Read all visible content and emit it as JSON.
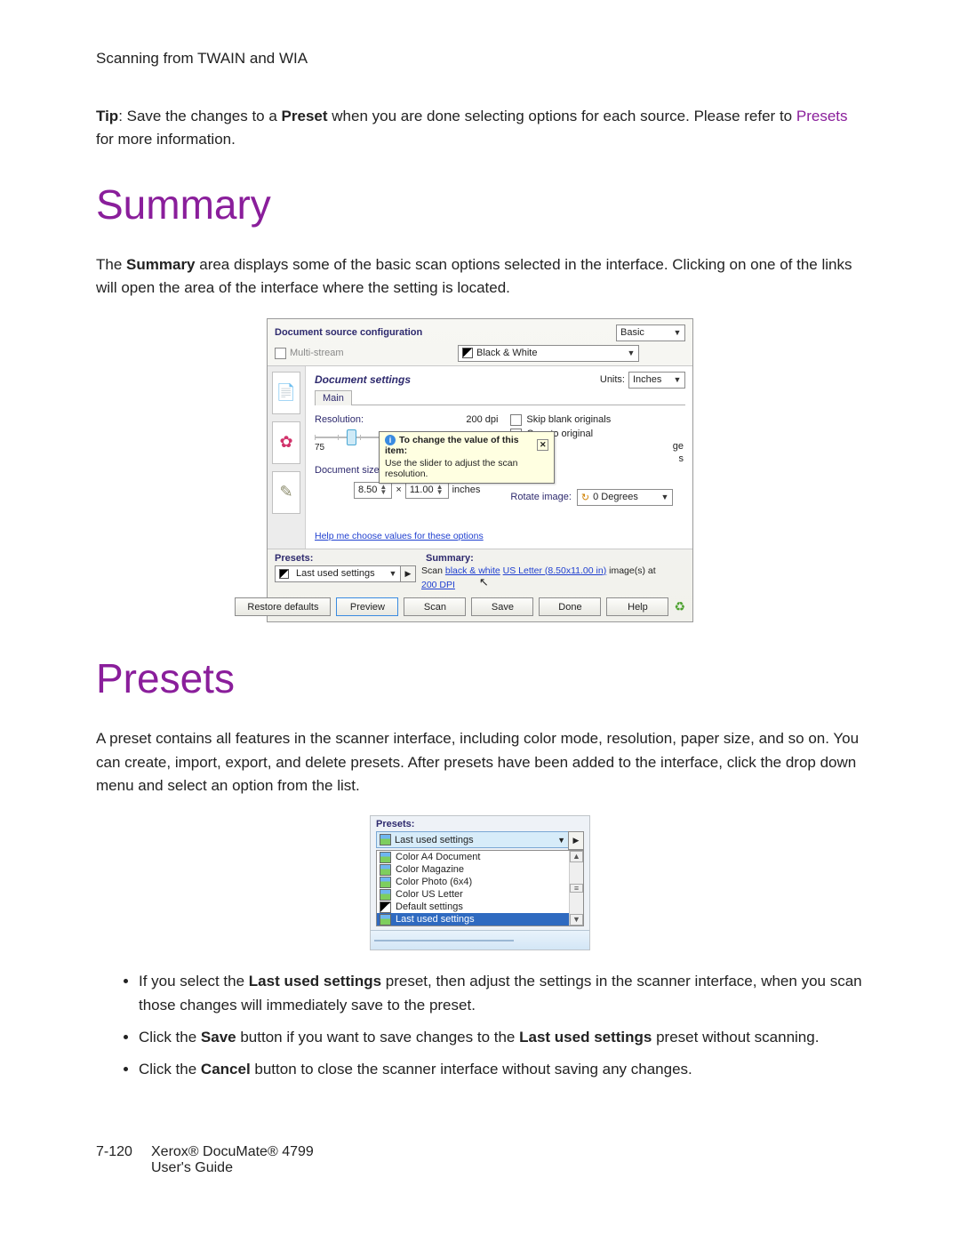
{
  "header": "Scanning from TWAIN and WIA",
  "tip": {
    "label": "Tip",
    "text1": ": Save the changes to a ",
    "bold1": "Preset",
    "text2": " when you are done selecting options for each source. Please refer to ",
    "link": "Presets",
    "text3": " for more information."
  },
  "sections": {
    "summary_title": "Summary",
    "summary_body_pre": "The ",
    "summary_body_bold": "Summary",
    "summary_body_post": " area displays some of the basic scan options selected in the interface. Clicking on one of the links will open the area of the interface where the setting is located.",
    "presets_title": "Presets",
    "presets_body": "A preset contains all features in the scanner interface, including color mode, resolution, paper size, and so on. You can create, import, export, and delete presets. After presets have been added to the interface, click the drop down menu and select an option from the list."
  },
  "dlg": {
    "src_cfg": "Document source configuration",
    "basic": "Basic",
    "multi": "Multi-stream",
    "bw": "Black & White",
    "panel_title": "Document settings",
    "units_label": "Units:",
    "units_value": "Inches",
    "tab": "Main",
    "resolution": "Resolution:",
    "res_value": "200 dpi",
    "slider_min": "75",
    "doc_size": "Document size:",
    "width": "8.50",
    "height": "11.00",
    "inches": "inches",
    "skip": "Skip blank originals",
    "crop": "Crop to original",
    "ge": "ge",
    "s_char": "s",
    "rotate": "Rotate image:",
    "rotate_value": "0 Degrees",
    "tooltip_t1": "To change the value of this item:",
    "tooltip_t2": "Use the slider to adjust the scan resolution.",
    "help_link": "Help me choose values for these options",
    "presets": "Presets:",
    "preset_value": "Last used settings",
    "summary": "Summary:",
    "sum1": "Scan ",
    "sum_u1": "black & white",
    "sum_sp": " ",
    "sum_u2": "US Letter (8.50x11.00 in)",
    "sum2": " image(s) at ",
    "sum_u3": "200 DPI",
    "btn_restore": "Restore defaults",
    "btn_preview": "Preview",
    "btn_scan": "Scan",
    "btn_save": "Save",
    "btn_done": "Done",
    "btn_help": "Help"
  },
  "preset_shot": {
    "label": "Presets:",
    "selected": "Last used settings",
    "items": {
      "i0": "Color A4 Document",
      "i1": "Color Magazine",
      "i2": "Color Photo (6x4)",
      "i3": "Color US Letter",
      "i4": "Default settings",
      "i5": "Last used settings"
    }
  },
  "bullets": {
    "b1a": "If you select the ",
    "b1b": "Last used settings",
    "b1c": " preset, then adjust the settings in the scanner interface, when you scan those changes will immediately save to the preset.",
    "b2a": "Click the ",
    "b2b": "Save",
    "b2c": " button if you want to save changes to the ",
    "b2d": "Last used settings",
    "b2e": " preset without scanning.",
    "b3a": "Click the ",
    "b3b": "Cancel",
    "b3c": " button to close the scanner interface without saving any changes."
  },
  "footer": {
    "page": "7-120",
    "line1": "Xerox® DocuMate® 4799",
    "line2": "User's Guide"
  }
}
